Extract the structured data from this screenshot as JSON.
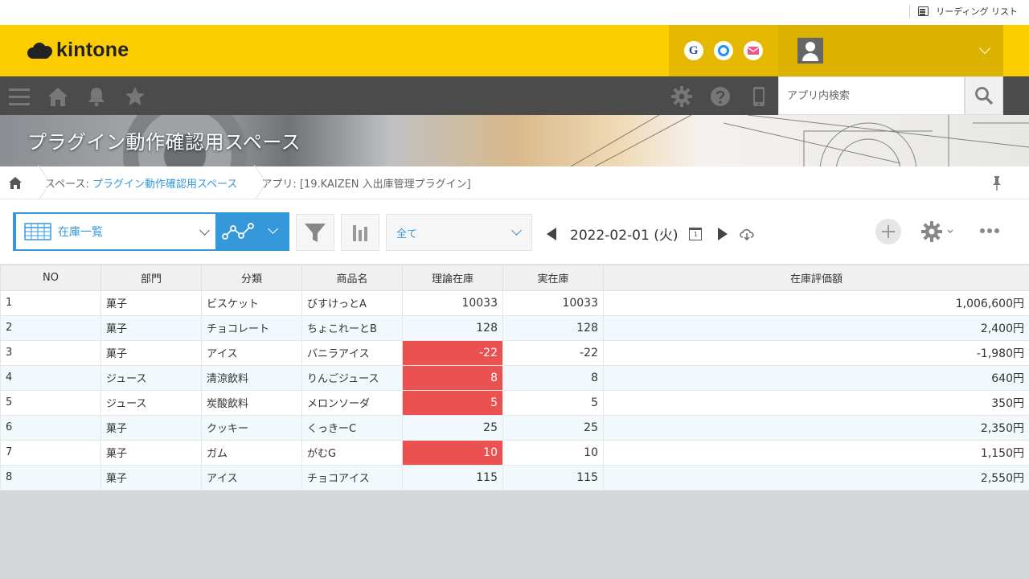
{
  "browser": {
    "reading_list": "リーディング リスト"
  },
  "header": {
    "logo_text": "kintone",
    "brand_color": "#fccd00",
    "icons": [
      "g-circle-icon",
      "ring-circle-icon",
      "mail-circle-icon"
    ],
    "g_label": "G"
  },
  "nav": {
    "search_placeholder": "アプリ内検索"
  },
  "banner": {
    "title": "プラグイン動作確認用スペース"
  },
  "breadcrumb": {
    "space_prefix": "スペース: ",
    "space_link": "プラグイン動作確認用スペース",
    "app_label": "アプリ: [19.KAIZEN 入出庫管理プラグイン]"
  },
  "toolbar": {
    "view_name": "在庫一覧",
    "filter_value": "全て",
    "date": "2022-02-01 (火)",
    "calendar_day": "1"
  },
  "table": {
    "columns": [
      "NO",
      "部門",
      "分類",
      "商品名",
      "理論在庫",
      "実在庫",
      "在庫評価額"
    ],
    "rows": [
      {
        "no": "1",
        "dept": "菓子",
        "category": "ビスケット",
        "product": "びすけっとA",
        "theory": "10033",
        "actual": "10033",
        "value": "1,006,600円",
        "alert": false
      },
      {
        "no": "2",
        "dept": "菓子",
        "category": "チョコレート",
        "product": "ちょこれーとB",
        "theory": "128",
        "actual": "128",
        "value": "2,400円",
        "alert": false
      },
      {
        "no": "3",
        "dept": "菓子",
        "category": "アイス",
        "product": "バニラアイス",
        "theory": "-22",
        "actual": "-22",
        "value": "-1,980円",
        "alert": true
      },
      {
        "no": "4",
        "dept": "ジュース",
        "category": "清涼飲料",
        "product": "りんごジュース",
        "theory": "8",
        "actual": "8",
        "value": "640円",
        "alert": true
      },
      {
        "no": "5",
        "dept": "ジュース",
        "category": "炭酸飲料",
        "product": "メロンソーダ",
        "theory": "5",
        "actual": "5",
        "value": "350円",
        "alert": true
      },
      {
        "no": "6",
        "dept": "菓子",
        "category": "クッキー",
        "product": "くっきーC",
        "theory": "25",
        "actual": "25",
        "value": "2,350円",
        "alert": false
      },
      {
        "no": "7",
        "dept": "菓子",
        "category": "ガム",
        "product": "がむG",
        "theory": "10",
        "actual": "10",
        "value": "1,150円",
        "alert": true
      },
      {
        "no": "8",
        "dept": "菓子",
        "category": "アイス",
        "product": "チョコアイス",
        "theory": "115",
        "actual": "115",
        "value": "2,550円",
        "alert": false
      }
    ]
  },
  "colors": {
    "accent": "#3498db",
    "alert": "#ec5151",
    "nav": "#4b4b4b"
  }
}
